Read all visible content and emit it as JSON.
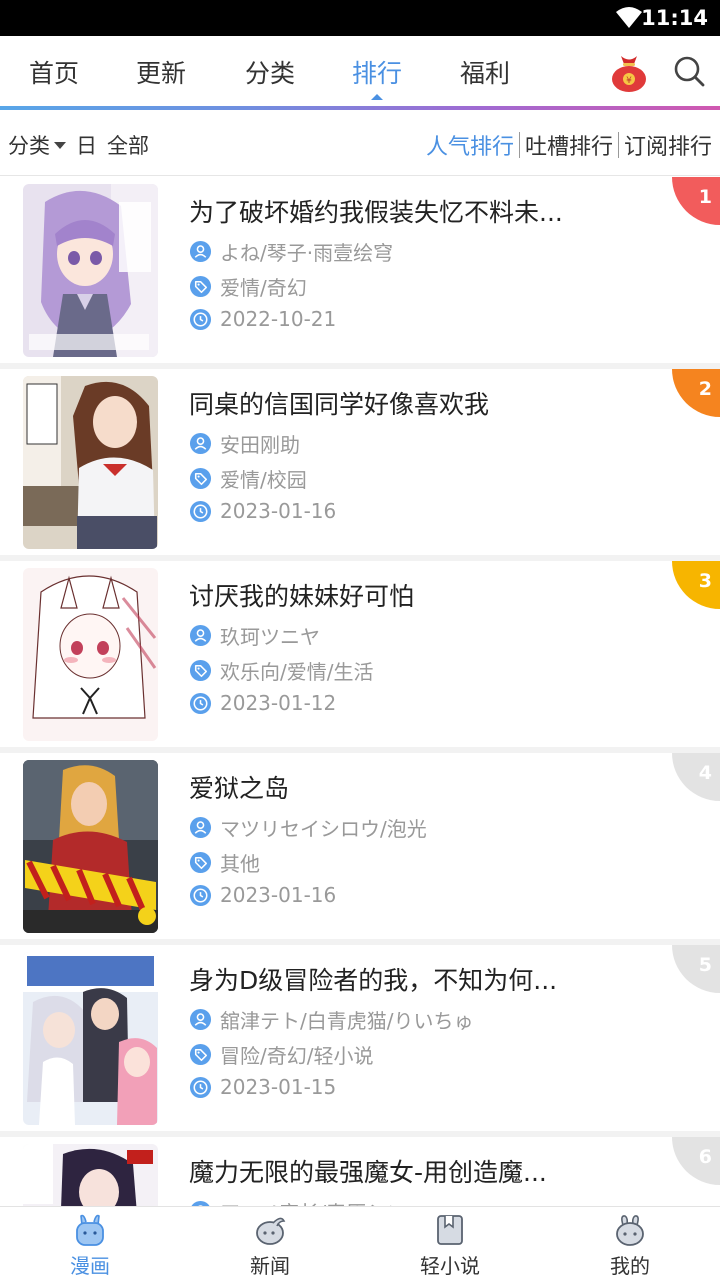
{
  "status_bar": {
    "time": "11:14"
  },
  "top_nav": {
    "tabs": [
      {
        "label": "首页"
      },
      {
        "label": "更新"
      },
      {
        "label": "分类"
      },
      {
        "label": "排行"
      },
      {
        "label": "福利"
      }
    ],
    "active_tab": "排行",
    "accent_color": "#4a90e2"
  },
  "filter_bar": {
    "category_label": "分类",
    "period": "日",
    "scope": "全部",
    "sort_options": [
      {
        "label": "人气排行"
      },
      {
        "label": "吐槽排行"
      },
      {
        "label": "订阅排行"
      }
    ],
    "active_sort": "人气排行"
  },
  "ranking": [
    {
      "rank": "1",
      "title": "为了破坏婚约我假装失忆不料未...",
      "authors": "よね/琴子·雨壹绘穹",
      "tags": "爱情/奇幻",
      "date": "2022-10-21",
      "badge_color": "#f25c5c"
    },
    {
      "rank": "2",
      "title": "同桌的信国同学好像喜欢我",
      "authors": "安田刚助",
      "tags": "爱情/校园",
      "date": "2023-01-16",
      "badge_color": "#f5841f"
    },
    {
      "rank": "3",
      "title": "讨厌我的妹妹好可怕",
      "authors": "玖珂ツニヤ",
      "tags": "欢乐向/爱情/生活",
      "date": "2023-01-12",
      "badge_color": "#f7b500"
    },
    {
      "rank": "4",
      "title": "爱狱之岛",
      "authors": "マツリセイシロウ/泡光",
      "tags": "其他",
      "date": "2023-01-16",
      "badge_color": "#e3e3e3"
    },
    {
      "rank": "5",
      "title": "身为D级冒险者的我，不知为何...",
      "authors": "舘津テト/白青虎猫/りいちゅ",
      "tags": "冒险/奇幻/轻小说",
      "date": "2023-01-15",
      "badge_color": "#e3e3e3"
    },
    {
      "rank": "6",
      "title": "魔力无限的最强魔女-用创造魔...",
      "authors": "アマノ宮长/春原シン",
      "tags": "",
      "date": "",
      "badge_color": "#e3e3e3"
    }
  ],
  "bottom_nav": {
    "items": [
      {
        "label": "漫画",
        "icon": "comic-rabbit-icon"
      },
      {
        "label": "新闻",
        "icon": "news-icon"
      },
      {
        "label": "轻小说",
        "icon": "novel-book-icon"
      },
      {
        "label": "我的",
        "icon": "profile-rabbit-icon"
      }
    ],
    "active": "漫画"
  }
}
